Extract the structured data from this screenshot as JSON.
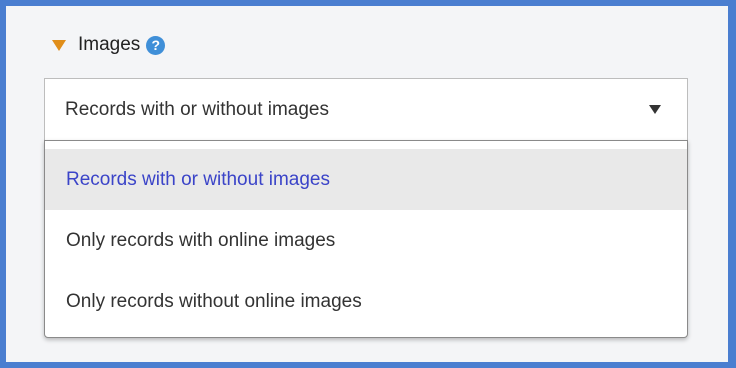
{
  "facet": {
    "title": "Images",
    "help_icon": "question-circle-icon",
    "toggle_icon": "triangle-down-icon"
  },
  "select": {
    "value": "Records with or without images",
    "arrow_icon": "caret-down-icon",
    "options": [
      {
        "label": "Records with or without images",
        "selected": true
      },
      {
        "label": "Only records with online images",
        "selected": false
      },
      {
        "label": "Only records without online images",
        "selected": false
      }
    ]
  },
  "colors": {
    "frame": "#4a7ed0",
    "panel": "#f4f5f7",
    "toggle": "#e08e1a",
    "help": "#3f8fd8",
    "selected_text": "#3b44c8",
    "selected_bg": "#e9e9e9"
  }
}
